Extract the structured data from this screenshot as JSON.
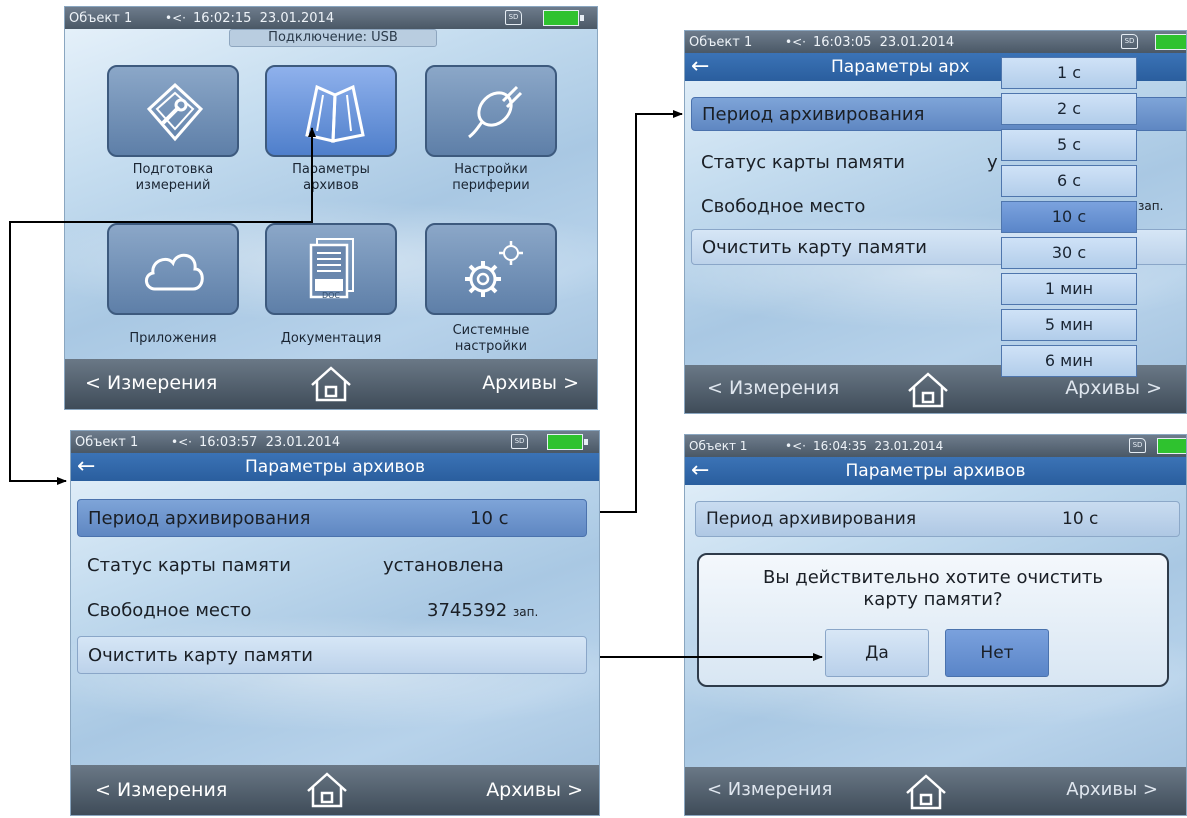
{
  "common": {
    "object": "Объект 1",
    "usb_glyph": "•<·",
    "back_glyph": "←",
    "nav_left": "< Измерения",
    "nav_right": "Архивы >",
    "sd_label": "SD"
  },
  "screen1": {
    "time": "16:02:15",
    "date": "23.01.2014",
    "connection": "Подключение: USB",
    "tiles": [
      {
        "line1": "Подготовка",
        "line2": "измерений"
      },
      {
        "line1": "Параметры",
        "line2": "архивов"
      },
      {
        "line1": "Настройки",
        "line2": "периферии"
      },
      {
        "line1": "Приложения",
        "line2": ""
      },
      {
        "line1": "Документация",
        "line2": ""
      },
      {
        "line1": "Системные",
        "line2": "настройки"
      }
    ],
    "doc_badge": "DOC"
  },
  "screen2": {
    "time": "16:03:05",
    "date": "23.01.2014",
    "title": "Параметры арх",
    "rows": [
      {
        "label": "Период архивирования"
      },
      {
        "label": "Статус карты памяти",
        "value": "у"
      },
      {
        "label": "Свободное место",
        "value": "зап."
      },
      {
        "label": "Очистить карту памяти"
      }
    ],
    "dropdown": [
      "1 с",
      "2 с",
      "5 с",
      "6 с",
      "10 с",
      "30 с",
      "1 мин",
      "5 мин",
      "6 мин"
    ],
    "dropdown_selected": "10 с"
  },
  "screen3": {
    "time": "16:03:57",
    "date": "23.01.2014",
    "title": "Параметры архивов",
    "rows": [
      {
        "label": "Период архивирования",
        "value": "10 с"
      },
      {
        "label": "Статус карты памяти",
        "value": "установлена"
      },
      {
        "label": "Свободное место",
        "value": "3745392",
        "unit": "зап."
      },
      {
        "label": "Очистить карту памяти"
      }
    ]
  },
  "screen4": {
    "time": "16:04:35",
    "date": "23.01.2014",
    "title": "Параметры архивов",
    "period_label": "Период архивирования",
    "period_value": "10 с",
    "dialog_line1": "Вы действительно хотите очистить",
    "dialog_line2": "карту памяти?",
    "yes": "Да",
    "no": "Нет"
  },
  "colors": {
    "titlebar": "#2f66a8",
    "selected_row": "#6b92cc",
    "battery": "#2fc22f",
    "statusbar": "#55636f"
  }
}
